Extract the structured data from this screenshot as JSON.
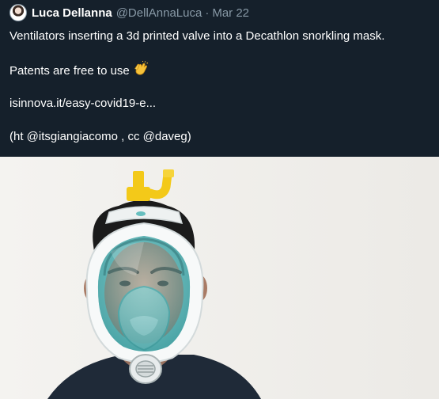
{
  "tweet": {
    "author_name": "Luca Dellanna",
    "author_handle": "@DellAnnaLuca",
    "separator": "·",
    "date": "Mar 22",
    "line1": "Ventilators inserting a 3d printed valve into a Decathlon snorkling mask.",
    "line2": "Patents are free to use",
    "line2_emoji": "clapping-hands-icon",
    "link": "isinnova.it/easy-covid19-e...",
    "line4": "(ht @itsgiangiacomo , cc @daveg)"
  },
  "colors": {
    "background": "#15202b",
    "secondary_text": "#8899a6",
    "mask_teal": "#5fb7b8",
    "valve_yellow": "#f3c919"
  }
}
